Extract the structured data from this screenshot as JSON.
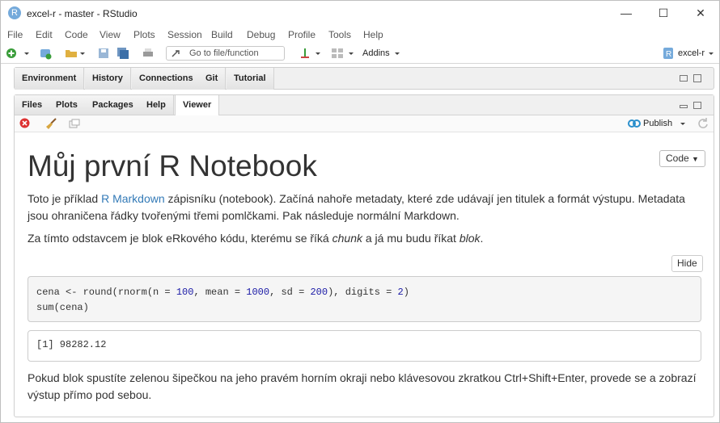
{
  "window": {
    "title": "excel-r - master - RStudio",
    "app_icon_letter": "R"
  },
  "menu": [
    "File",
    "Edit",
    "Code",
    "View",
    "Plots",
    "Session",
    "Build",
    "Debug",
    "Profile",
    "Tools",
    "Help"
  ],
  "toolbar": {
    "goto_placeholder": "Go to file/function",
    "addins_label": "Addins",
    "project_label": "excel-r"
  },
  "top_pane": {
    "tabs": [
      "Environment",
      "History",
      "Connections",
      "Git",
      "Tutorial"
    ]
  },
  "bottom_pane": {
    "tabs": [
      "Files",
      "Plots",
      "Packages",
      "Help",
      "Viewer"
    ],
    "active_tab": "Viewer",
    "publish_label": "Publish"
  },
  "notebook": {
    "title": "Můj první R Notebook",
    "code_button": "Code",
    "para1_before_link": "Toto je příklad ",
    "para1_link": "R Markdown",
    "para1_after_link": " zápisníku (notebook). Začíná nahoře metadaty, které zde udávají jen titulek a formát výstupu. Metadata jsou ohraničena řádky tvořenými třemi pomlčkami. Pak následuje normální Markdown.",
    "para2_a": "Za tímto odstavcem je blok eRkového kódu, kterému se říká ",
    "para2_em1": "chunk",
    "para2_b": " a já mu budu říkat ",
    "para2_em2": "blok",
    "para2_c": ".",
    "hide_button": "Hide",
    "code_line1_a": "cena <- round(rnorm(n = ",
    "code_line1_n1": "100",
    "code_line1_b": ", mean = ",
    "code_line1_n2": "1000",
    "code_line1_c": ", sd = ",
    "code_line1_n3": "200",
    "code_line1_d": "), digits = ",
    "code_line1_n4": "2",
    "code_line1_e": ")",
    "code_line2": "sum(cena)",
    "output": "[1] 98282.12",
    "para3": "Pokud blok spustíte zelenou šipečkou na jeho pravém horním okraji nebo klávesovou zkratkou Ctrl+Shift+Enter, provede se a zobrazí výstup přímo pod sebou."
  },
  "colors": {
    "r_blue": "#75aadb",
    "link": "#337ab7",
    "number": "#1a1aa6"
  }
}
